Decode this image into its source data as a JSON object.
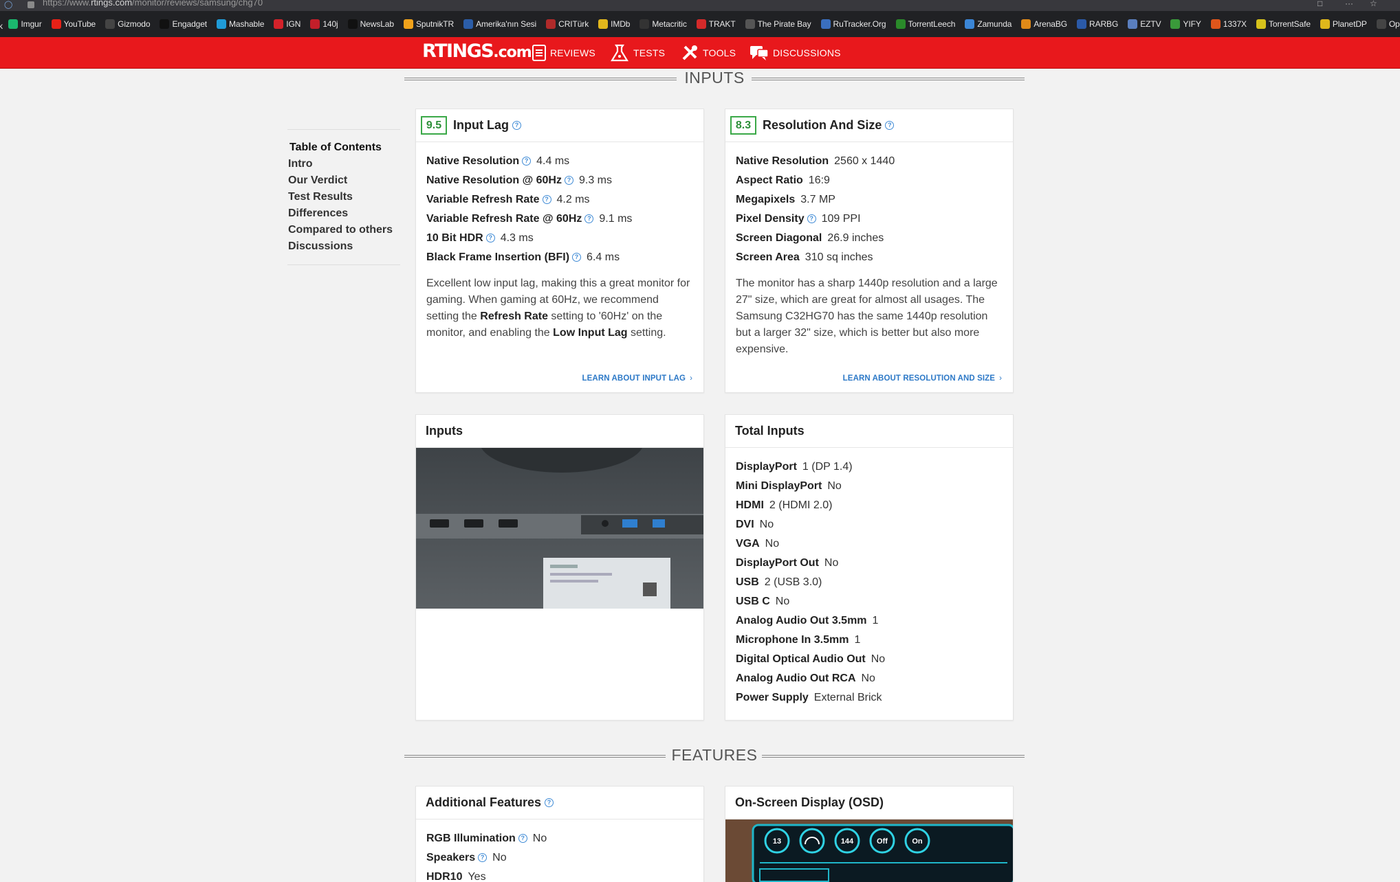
{
  "browser": {
    "url_prefix": "https://www.",
    "url_domain": "rtings.com",
    "url_path": "/monitor/reviews/samsung/chg70"
  },
  "bookmarks": {
    "lead": "k",
    "items": [
      {
        "label": "Imgur",
        "icon": "imgur-icon",
        "color": "#1bb76e"
      },
      {
        "label": "YouTube",
        "icon": "youtube-icon",
        "color": "#e62117"
      },
      {
        "label": "Gizmodo",
        "icon": "gizmodo-icon",
        "color": "#444444"
      },
      {
        "label": "Engadget",
        "icon": "engadget-icon",
        "color": "#111111"
      },
      {
        "label": "Mashable",
        "icon": "mashable-icon",
        "color": "#1f9bd7"
      },
      {
        "label": "IGN",
        "icon": "ign-icon",
        "color": "#d3222a"
      },
      {
        "label": "140j",
        "icon": "140j-icon",
        "color": "#c21f2a"
      },
      {
        "label": "NewsLab",
        "icon": "newslab-icon",
        "color": "#111111"
      },
      {
        "label": "SputnikTR",
        "icon": "sputnik-icon",
        "color": "#f0a21b"
      },
      {
        "label": "Amerika'nın Sesi",
        "icon": "voa-icon",
        "color": "#2b5da8"
      },
      {
        "label": "CRITürk",
        "icon": "crt-icon",
        "color": "#b02a2a"
      },
      {
        "label": "IMDb",
        "icon": "imdb-icon",
        "color": "#e3b81c"
      },
      {
        "label": "Metacritic",
        "icon": "metacritic-icon",
        "color": "#333333"
      },
      {
        "label": "TRAKT",
        "icon": "trakt-icon",
        "color": "#d42a2a"
      },
      {
        "label": "The Pirate Bay",
        "icon": "piratebay-icon",
        "color": "#555555"
      },
      {
        "label": "RuTracker.Org",
        "icon": "rutracker-icon",
        "color": "#3a6fbf"
      },
      {
        "label": "TorrentLeech",
        "icon": "torrentleech-icon",
        "color": "#2a8a2a"
      },
      {
        "label": "Zamunda",
        "icon": "zamunda-icon",
        "color": "#3b86d6"
      },
      {
        "label": "ArenaBG",
        "icon": "arenabg-icon",
        "color": "#e08a18"
      },
      {
        "label": "RARBG",
        "icon": "rarbg-icon",
        "color": "#2b5aa8"
      },
      {
        "label": "EZTV",
        "icon": "eztv-icon",
        "color": "#5a7fbf"
      },
      {
        "label": "YIFY",
        "icon": "yify-icon",
        "color": "#3a9a3a"
      },
      {
        "label": "1337X",
        "icon": "1337x-icon",
        "color": "#e0561b"
      },
      {
        "label": "TorrentSafe",
        "icon": "torrentsafe-icon",
        "color": "#d6c21b"
      },
      {
        "label": "PlanetDP",
        "icon": "planetdp-icon",
        "color": "#e0b81b"
      },
      {
        "label": "OpenSu",
        "icon": "opensubtitles-icon",
        "color": "#444444"
      }
    ]
  },
  "header": {
    "logo_main": "RTINGS",
    "logo_suffix": ".com",
    "nav": [
      {
        "label": "REVIEWS",
        "icon": "reviews-icon"
      },
      {
        "label": "TESTS",
        "icon": "tests-icon"
      },
      {
        "label": "TOOLS",
        "icon": "tools-icon"
      },
      {
        "label": "DISCUSSIONS",
        "icon": "discussions-icon"
      }
    ],
    "color": "#e8181c"
  },
  "sections": {
    "inputs": "INPUTS",
    "features": "FEATURES"
  },
  "toc": {
    "title": "Table of Contents",
    "items": [
      "Intro",
      "Our Verdict",
      "Test Results",
      "Differences",
      "Compared to others",
      "Discussions"
    ]
  },
  "input_lag": {
    "score": "9.5",
    "title": "Input Lag",
    "specs": [
      {
        "k": "Native Resolution",
        "v": "4.4 ms"
      },
      {
        "k": "Native Resolution @ 60Hz",
        "v": "9.3 ms"
      },
      {
        "k": "Variable Refresh Rate",
        "v": "4.2 ms"
      },
      {
        "k": "Variable Refresh Rate @ 60Hz",
        "v": "9.1 ms"
      },
      {
        "k": "10 Bit HDR",
        "v": "4.3 ms"
      },
      {
        "k": "Black Frame Insertion (BFI)",
        "v": "6.4 ms"
      }
    ],
    "desc_1": "Excellent low input lag, making this a great monitor for gaming. When gaming at 60Hz, we recommend setting the ",
    "desc_b1": "Refresh Rate",
    "desc_2": " setting to '60Hz' on the monitor, and enabling the ",
    "desc_b2": "Low Input Lag",
    "desc_3": " setting.",
    "learn": "LEARN ABOUT INPUT LAG"
  },
  "resolution": {
    "score": "8.3",
    "title": "Resolution And Size",
    "specs": [
      {
        "k": "Native Resolution",
        "v": "2560 x 1440"
      },
      {
        "k": "Aspect Ratio",
        "v": "16:9"
      },
      {
        "k": "Megapixels",
        "v": "3.7 MP"
      },
      {
        "k": "Pixel Density",
        "v": "109 PPI"
      },
      {
        "k": "Screen Diagonal",
        "v": "26.9 inches"
      },
      {
        "k": "Screen Area",
        "v": "310 sq inches"
      }
    ],
    "desc": "The monitor has a sharp 1440p resolution and a large 27\" size, which are great for almost all usages. The Samsung C32HG70 has the same 1440p resolution but a larger 32\" size, which is better but also more expensive.",
    "learn": "LEARN ABOUT RESOLUTION AND SIZE"
  },
  "inputs_card": {
    "title": "Inputs"
  },
  "total_inputs": {
    "title": "Total Inputs",
    "specs": [
      {
        "k": "DisplayPort",
        "v": "1 (DP 1.4)"
      },
      {
        "k": "Mini DisplayPort",
        "v": "No"
      },
      {
        "k": "HDMI",
        "v": "2 (HDMI 2.0)"
      },
      {
        "k": "DVI",
        "v": "No"
      },
      {
        "k": "VGA",
        "v": "No"
      },
      {
        "k": "DisplayPort Out",
        "v": "No"
      },
      {
        "k": "USB",
        "v": "2 (USB 3.0)"
      },
      {
        "k": "USB C",
        "v": "No"
      },
      {
        "k": "Analog Audio Out 3.5mm",
        "v": "1"
      },
      {
        "k": "Microphone In 3.5mm",
        "v": "1"
      },
      {
        "k": "Digital Optical Audio Out",
        "v": "No"
      },
      {
        "k": "Analog Audio Out RCA",
        "v": "No"
      },
      {
        "k": "Power Supply",
        "v": "External Brick"
      }
    ]
  },
  "additional_features": {
    "title": "Additional Features",
    "specs": [
      {
        "k": "RGB Illumination",
        "v": "No"
      },
      {
        "k": "Speakers",
        "v": "No"
      },
      {
        "k": "HDR10",
        "v": "Yes"
      }
    ]
  },
  "osd": {
    "title": "On-Screen Display (OSD)",
    "dials": [
      "13",
      "",
      "144",
      "Off",
      "On"
    ]
  },
  "colors": {
    "score_green": "#3aa847",
    "link_blue": "#2d79c7"
  }
}
